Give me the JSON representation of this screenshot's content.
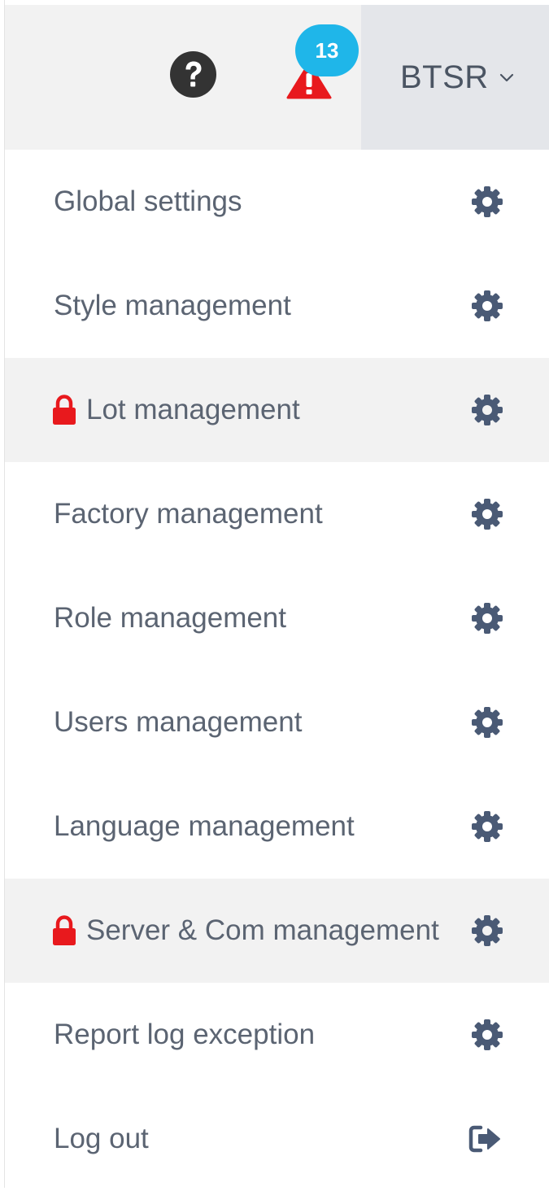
{
  "header": {
    "help_icon": "question-circle-icon",
    "alert_icon": "warning-triangle-icon",
    "alert_count": "13",
    "user_name": "BTSR",
    "colors": {
      "badge": "#1fb6e9",
      "alert": "#e8191d",
      "user_bg": "#e4e6ea",
      "header_bg": "#f2f2f2"
    }
  },
  "menu": {
    "items": [
      {
        "label": "Global settings",
        "icon": "gear-icon",
        "locked": false
      },
      {
        "label": "Style management",
        "icon": "gear-icon",
        "locked": false
      },
      {
        "label": "Lot management",
        "icon": "gear-icon",
        "locked": true
      },
      {
        "label": "Factory management",
        "icon": "gear-icon",
        "locked": false
      },
      {
        "label": "Role management",
        "icon": "gear-icon",
        "locked": false
      },
      {
        "label": "Users management",
        "icon": "gear-icon",
        "locked": false
      },
      {
        "label": "Language management",
        "icon": "gear-icon",
        "locked": false
      },
      {
        "label": "Server & Com management",
        "icon": "gear-icon",
        "locked": true
      },
      {
        "label": "Report log exception",
        "icon": "gear-icon",
        "locked": false
      },
      {
        "label": "Log out",
        "icon": "sign-out-icon",
        "locked": false
      }
    ],
    "colors": {
      "text": "#5b6472",
      "icon": "#4a5a75",
      "lock": "#e8191d",
      "shaded_bg": "#f2f2f2"
    }
  }
}
